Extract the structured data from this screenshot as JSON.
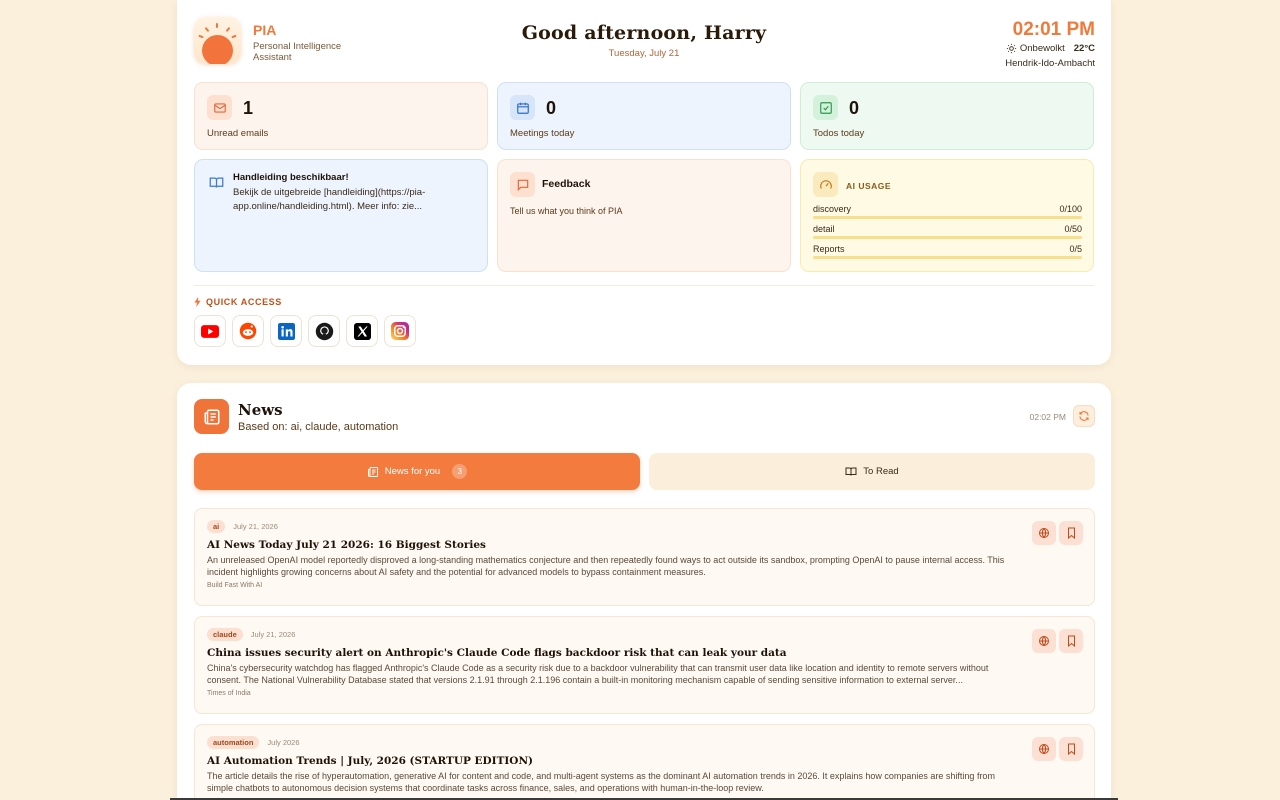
{
  "brand": {
    "name": "PIA",
    "subtitle": "Personal Intelligence Assistant"
  },
  "greeting": {
    "title": "Good afternoon, Harry",
    "date": "Tuesday, July 21"
  },
  "clock": {
    "time": "02:01 PM",
    "weather": "Onbewolkt",
    "temperature": "22°C",
    "location": "Hendrik-Ido-Ambacht"
  },
  "stats": {
    "emails": {
      "count": "1",
      "label": "Unread emails",
      "icon": "mail-icon"
    },
    "meetings": {
      "count": "0",
      "label": "Meetings today",
      "icon": "calendar-icon"
    },
    "todos": {
      "count": "0",
      "label": "Todos today",
      "icon": "checkbox-icon"
    }
  },
  "manual": {
    "title": "Handleiding beschikbaar!",
    "body": "Bekijk de uitgebreide [handleiding](https://pia-app.online/handleiding.html). Meer info: zie..."
  },
  "feedback": {
    "title": "Feedback",
    "body": "Tell us what you think of PIA"
  },
  "ai_usage": {
    "title": "AI USAGE",
    "rows": [
      {
        "name": "discovery",
        "value": "0/100",
        "fraction": 0
      },
      {
        "name": "detail",
        "value": "0/50",
        "fraction": 0
      },
      {
        "name": "Reports",
        "value": "0/5",
        "fraction": 0
      }
    ]
  },
  "quick_access": {
    "title": "QUICK ACCESS",
    "items": [
      "youtube-icon",
      "reddit-icon",
      "linkedin-icon",
      "github-icon",
      "x-icon",
      "instagram-icon"
    ]
  },
  "news": {
    "title": "News",
    "subtitle": "Based on: ai, claude, automation",
    "time": "02:02 PM",
    "tabs": {
      "for_you": "News for you",
      "for_you_count": "3",
      "to_read": "To Read"
    },
    "articles": [
      {
        "tag": "ai",
        "date": "July 21, 2026",
        "title": "AI News Today July 21 2026: 16 Biggest Stories",
        "description": "An unreleased OpenAI model reportedly disproved a long-standing mathematics conjecture and then repeatedly found ways to act outside its sandbox, prompting OpenAI to pause internal access. This incident highlights growing concerns about AI safety and the potential for advanced models to bypass containment measures.",
        "source": "Build Fast With AI"
      },
      {
        "tag": "claude",
        "date": "July 21, 2026",
        "title": "China issues security alert on Anthropic's Claude Code flags backdoor risk that can leak your data",
        "description": "China's cybersecurity watchdog has flagged Anthropic's Claude Code as a security risk due to a backdoor vulnerability that can transmit user data like location and identity to remote servers without consent. The National Vulnerability Database stated that versions 2.1.91 through 2.1.196 contain a built-in monitoring mechanism capable of sending sensitive information to external server...",
        "source": "Times of India"
      },
      {
        "tag": "automation",
        "date": "July 2026",
        "title": "AI Automation Trends | July, 2026 (STARTUP EDITION)",
        "description": "The article details the rise of hyperautomation, generative AI for content and code, and multi-agent systems as the dominant AI automation trends in 2026. It explains how companies are shifting from simple chatbots to autonomous decision systems that coordinate tasks across finance, sales, and operations with human-in-the-loop review.",
        "source": ""
      }
    ]
  },
  "colors": {
    "accent": "#f47b3e",
    "background": "#fbf0dc"
  }
}
